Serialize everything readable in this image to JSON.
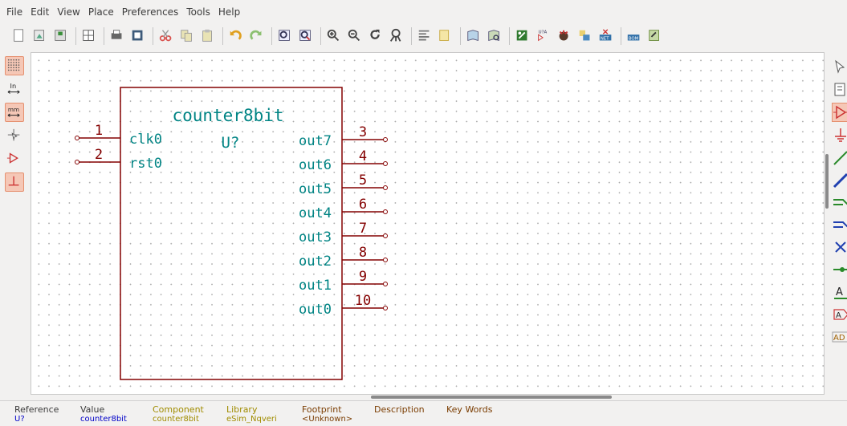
{
  "menu": [
    "File",
    "Edit",
    "View",
    "Place",
    "Preferences",
    "Tools",
    "Help"
  ],
  "toolbar_icons": [
    "new-sheet-icon",
    "load-sheet-icon",
    "save-icon",
    "separator",
    "page-settings-icon",
    "separator",
    "print-icon",
    "plot-icon",
    "separator",
    "cut-icon",
    "copy-icon",
    "paste-icon",
    "separator",
    "undo-icon",
    "redo-icon",
    "separator",
    "find-icon",
    "find-replace-icon",
    "separator",
    "zoom-in-icon",
    "zoom-out-icon",
    "redraw-icon",
    "zoom-fit-icon",
    "separator",
    "hierarchy-navigator-icon",
    "leave-sheet-icon",
    "separator",
    "library-editor-icon",
    "library-browser-icon",
    "separator",
    "annotate-icon",
    "erc-icon",
    "cvpcb-icon",
    "netlist-icon",
    "bom-icon",
    "separator",
    "edit-pcb-icon",
    "back-import-icon"
  ],
  "left_tools": [
    {
      "name": "grid-toggle-icon",
      "active": true
    },
    {
      "name": "units-inch-icon",
      "active": false,
      "text": "In"
    },
    {
      "name": "units-mm-icon",
      "active": true,
      "text": "mm"
    },
    {
      "name": "cursor-shape-icon",
      "active": false
    },
    {
      "name": "hidden-pins-icon",
      "active": false
    },
    {
      "name": "wire-orientation-icon",
      "active": true
    }
  ],
  "right_tools": [
    "select-arrow-icon",
    "hierarchy-navigate-icon",
    "place-component-icon",
    "place-power-icon",
    "place-wire-icon",
    "place-bus-icon",
    "wire-entry-icon",
    "bus-entry-icon",
    "no-connect-icon",
    "junction-icon",
    "net-label-icon",
    "global-label-icon",
    "hierarchical-label-icon"
  ],
  "right_tool_texts": {
    "net_label": "A",
    "global_label": "A",
    "hier_label": "AD"
  },
  "component": {
    "name": "counter8bit",
    "reference": "U?",
    "left_pins": [
      {
        "number": "1",
        "name": "clk0"
      },
      {
        "number": "2",
        "name": "rst0"
      }
    ],
    "right_pins": [
      {
        "number": "3",
        "name": "out7"
      },
      {
        "number": "4",
        "name": "out6"
      },
      {
        "number": "5",
        "name": "out5"
      },
      {
        "number": "6",
        "name": "out4"
      },
      {
        "number": "7",
        "name": "out3"
      },
      {
        "number": "8",
        "name": "out2"
      },
      {
        "number": "9",
        "name": "out1"
      },
      {
        "number": "10",
        "name": "out0"
      }
    ]
  },
  "message_panel": {
    "reference": {
      "label": "Reference",
      "value": "U?"
    },
    "value": {
      "label": "Value",
      "value": "counter8bit"
    },
    "component": {
      "label": "Component",
      "value": "counter8bit"
    },
    "library": {
      "label": "Library",
      "value": "eSim_Nqveri"
    },
    "footprint": {
      "label": "Footprint",
      "value": "<Unknown>"
    },
    "description": {
      "label": "Description",
      "value": ""
    },
    "keywords": {
      "label": "Key Words",
      "value": ""
    }
  },
  "colors": {
    "body_outline": "#840000",
    "pin_line": "#840000",
    "pin_text": "#008484",
    "component_label": "#008484",
    "msg_label_yellow": "#a08c00",
    "msg_value_blue": "#0000c8",
    "msg_value_teal": "#007878"
  }
}
